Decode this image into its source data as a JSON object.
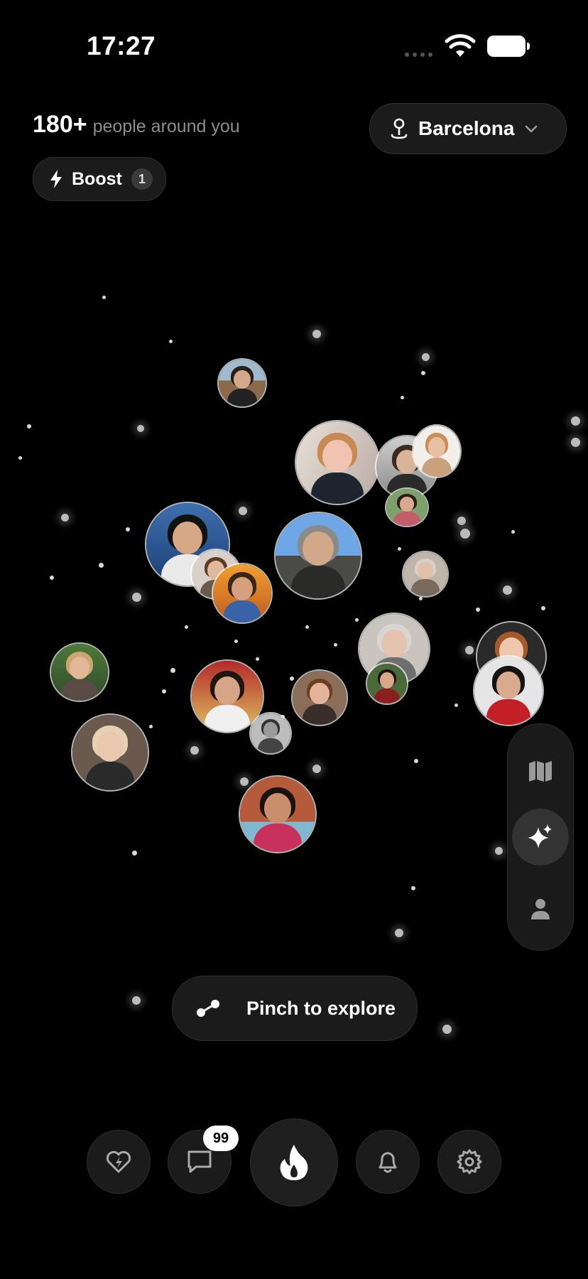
{
  "status_bar": {
    "time": "17:27"
  },
  "header": {
    "people_count": "180+",
    "people_label": "people around you",
    "city": "Barcelona",
    "boost_label": "Boost",
    "boost_count": "1"
  },
  "hint": {
    "label": "Pinch to explore"
  },
  "side_rail": {
    "items": [
      {
        "icon": "map-icon",
        "active": false
      },
      {
        "icon": "sparkles-icon",
        "active": true
      },
      {
        "icon": "person-icon",
        "active": false
      }
    ]
  },
  "bottom_nav": {
    "items": [
      {
        "icon": "heart-bolt-icon"
      },
      {
        "icon": "chat-bubble-icon",
        "badge": "99"
      },
      {
        "icon": "flame-icon"
      },
      {
        "icon": "bell-icon"
      },
      {
        "icon": "gear-icon"
      }
    ]
  },
  "colors": {
    "background": "#000000",
    "pill": "#1b1b1b",
    "accent": "#ffffff"
  }
}
